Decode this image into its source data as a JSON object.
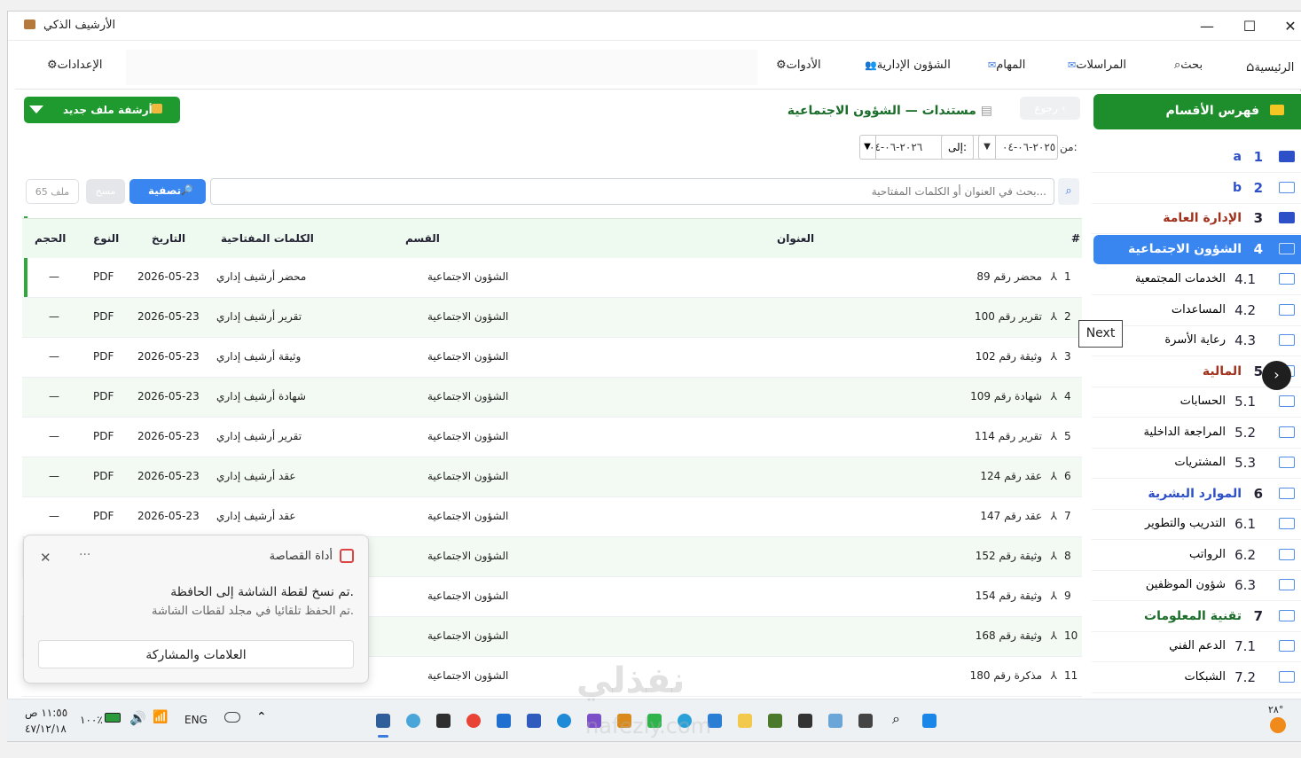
{
  "window": {
    "title": "الأرشيف الذكي"
  },
  "nav": {
    "home": "الرئيسية",
    "search": "بحث",
    "correspondence": "المراسلات",
    "tasks": "المهام",
    "admin": "الشؤون الإدارية",
    "tools": "الأدوات",
    "settings": "الإعدادات"
  },
  "sidebar": {
    "header": "فهرس الأقسام",
    "items": [
      {
        "num": "1",
        "label": "a",
        "level": 1
      },
      {
        "num": "2",
        "label": "b",
        "level": 1
      },
      {
        "num": "3",
        "label": "الإدارة العامة",
        "level": 1
      },
      {
        "num": "4",
        "label": "الشؤون الاجتماعية",
        "level": 1,
        "active": true
      },
      {
        "num": "4.1",
        "label": "الخدمات المجتمعية",
        "level": 2
      },
      {
        "num": "4.2",
        "label": "المساعدات",
        "level": 2
      },
      {
        "num": "4.3",
        "label": "رعاية الأسرة",
        "level": 2
      },
      {
        "num": "5",
        "label": "المالية",
        "level": 1
      },
      {
        "num": "5.1",
        "label": "الحسابات",
        "level": 2
      },
      {
        "num": "5.2",
        "label": "المراجعة الداخلية",
        "level": 2
      },
      {
        "num": "5.3",
        "label": "المشتريات",
        "level": 2
      },
      {
        "num": "6",
        "label": "الموارد البشرية",
        "level": 1
      },
      {
        "num": "6.1",
        "label": "التدريب والتطوير",
        "level": 2
      },
      {
        "num": "6.2",
        "label": "الرواتب",
        "level": 2
      },
      {
        "num": "6.3",
        "label": "شؤون الموظفين",
        "level": 2
      },
      {
        "num": "7",
        "label": "تقنية المعلومات",
        "level": 1
      },
      {
        "num": "7.1",
        "label": "الدعم الفني",
        "level": 2
      },
      {
        "num": "7.2",
        "label": "الشبكات",
        "level": 2
      }
    ]
  },
  "toolbar": {
    "new_file": "أرشفة ملف جديد",
    "back": "رجوع",
    "breadcrumb_root": "مستندات",
    "breadcrumb_sep": "—",
    "breadcrumb_current": "الشؤون الاجتماعية",
    "from_label": "من:",
    "from_date": "٢٠٢٥-٠٦-٠٤",
    "to_label": "إلى:",
    "to_date": "٢٠٢٦-٠٦-٠٤",
    "search_placeholder": "بحث في العنوان أو الكلمات المفتاحية...",
    "filter": "تصفية",
    "clear": "مسح",
    "count": "65 ملف"
  },
  "table": {
    "headers": {
      "num": "#",
      "title": "العنوان",
      "section": "القسم",
      "keywords": "الكلمات المفتاحية",
      "date": "التاريخ",
      "type": "النوع",
      "size": "الحجم"
    },
    "rows": [
      {
        "num": "1",
        "title": "محضر رقم 89",
        "section": "الشؤون الاجتماعية",
        "keywords": "محضر أرشيف إداري",
        "date": "2026-05-23",
        "type": "PDF",
        "size": "—"
      },
      {
        "num": "2",
        "title": "تقرير رقم 100",
        "section": "الشؤون الاجتماعية",
        "keywords": "تقرير أرشيف إداري",
        "date": "2026-05-23",
        "type": "PDF",
        "size": "—"
      },
      {
        "num": "3",
        "title": "وثيقة رقم 102",
        "section": "الشؤون الاجتماعية",
        "keywords": "وثيقة أرشيف إداري",
        "date": "2026-05-23",
        "type": "PDF",
        "size": "—"
      },
      {
        "num": "4",
        "title": "شهادة رقم 109",
        "section": "الشؤون الاجتماعية",
        "keywords": "شهادة أرشيف إداري",
        "date": "2026-05-23",
        "type": "PDF",
        "size": "—"
      },
      {
        "num": "5",
        "title": "تقرير رقم 114",
        "section": "الشؤون الاجتماعية",
        "keywords": "تقرير أرشيف إداري",
        "date": "2026-05-23",
        "type": "PDF",
        "size": "—"
      },
      {
        "num": "6",
        "title": "عقد رقم 124",
        "section": "الشؤون الاجتماعية",
        "keywords": "عقد أرشيف إداري",
        "date": "2026-05-23",
        "type": "PDF",
        "size": "—"
      },
      {
        "num": "7",
        "title": "عقد رقم 147",
        "section": "الشؤون الاجتماعية",
        "keywords": "عقد أرشيف إداري",
        "date": "2026-05-23",
        "type": "PDF",
        "size": "—"
      },
      {
        "num": "8",
        "title": "وثيقة رقم 152",
        "section": "الشؤون الاجتماعية"
      },
      {
        "num": "9",
        "title": "وثيقة رقم 154",
        "section": "الشؤون الاجتماعية"
      },
      {
        "num": "10",
        "title": "وثيقة رقم 168",
        "section": "الشؤون الاجتماعية"
      },
      {
        "num": "11",
        "title": "مذكرة رقم 180",
        "section": "الشؤون الاجتماعية"
      }
    ]
  },
  "snip": {
    "app": "أداة القصاصة",
    "message": "تم نسخ لقطة الشاشة إلى الحافظة.",
    "sub": "تم الحفظ تلقائيا في مجلد لقطات الشاشة.",
    "button": "العلامات والمشاركة"
  },
  "tooltip": "Next",
  "taskbar": {
    "time": "١١:٥٥ ص",
    "date": "٤٧/١٢/١٨",
    "battery": "١٠٠٪",
    "lang": "ENG",
    "temp": "٢٨°"
  },
  "watermark": {
    "text": "نفذلي",
    "url": "nafezly.com"
  },
  "colors": {
    "accent_green": "#1e8e2c",
    "active_blue": "#3a86f0",
    "pdf_red": "#e23d2d"
  }
}
